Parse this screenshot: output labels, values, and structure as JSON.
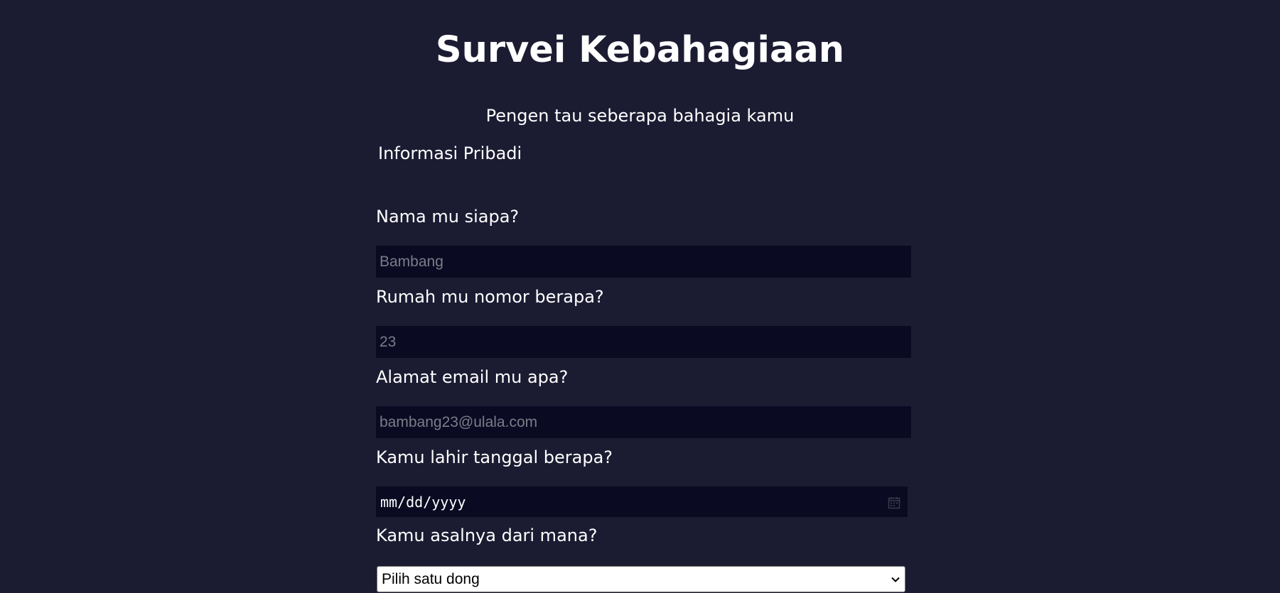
{
  "header": {
    "title": "Survei Kebahagiaan",
    "subtitle": "Pengen tau seberapa bahagia kamu"
  },
  "form": {
    "legend": "Informasi Pribadi",
    "name": {
      "label": "Nama mu siapa?",
      "placeholder": "Bambang",
      "value": ""
    },
    "house_number": {
      "label": "Rumah mu nomor berapa?",
      "placeholder": "23",
      "value": ""
    },
    "email": {
      "label": "Alamat email mu apa?",
      "placeholder": "bambang23@ulala.com",
      "value": ""
    },
    "birthdate": {
      "label": "Kamu lahir tanggal berapa?",
      "placeholder": "mm/dd/yyyy",
      "icon": "calendar-icon"
    },
    "origin": {
      "label": "Kamu asalnya dari mana?",
      "selected": "Pilih satu dong",
      "icon": "chevron-down-icon"
    }
  },
  "colors": {
    "background": "#1b1b32",
    "input_background": "#0a0a23",
    "text": "#ffffff",
    "placeholder": "#7c7c88"
  }
}
